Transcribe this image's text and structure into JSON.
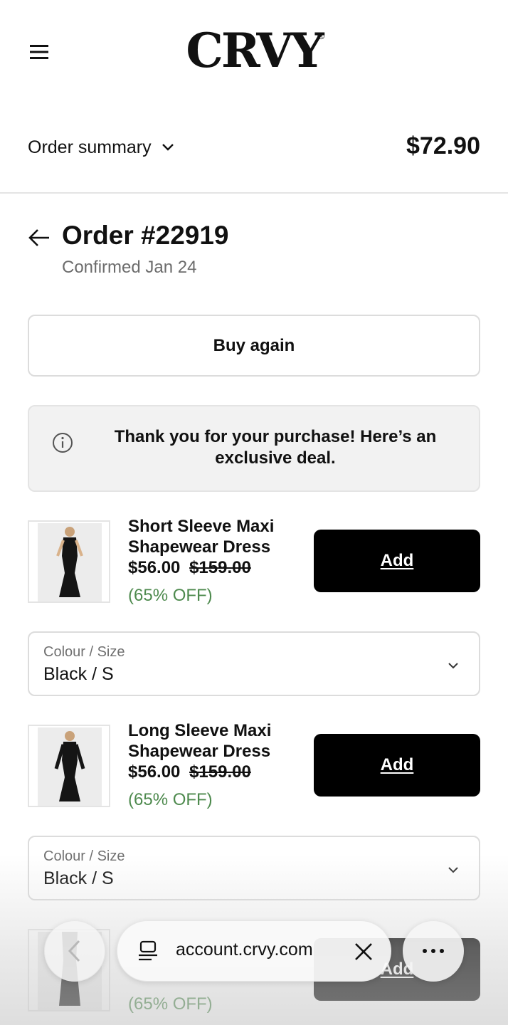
{
  "header": {
    "menu_icon": "hamburger-menu-icon",
    "brand": "CRVY",
    "brand_mark": "®"
  },
  "summary": {
    "label": "Order summary",
    "total": "$72.90"
  },
  "order": {
    "title": "Order #22919",
    "subtitle": "Confirmed Jan 24"
  },
  "actions": {
    "buy_again": "Buy again"
  },
  "notice": {
    "text": "Thank you for your purchase! Here’s an exclusive deal."
  },
  "products": [
    {
      "name": "Short Sleeve Maxi Shapewear Dress",
      "price": "$56.00",
      "compare_price": "$159.00",
      "discount": "(65% OFF)",
      "add_label": "Add",
      "option_label": "Colour / Size",
      "option_value": "Black / S"
    },
    {
      "name": "Long Sleeve Maxi Shapewear Dress",
      "price": "$56.00",
      "compare_price": "$159.00",
      "discount": "(65% OFF)",
      "add_label": "Add",
      "option_label": "Colour / Size",
      "option_value": "Black / S"
    },
    {
      "discount": "(65% OFF)",
      "add_label": "Add"
    }
  ],
  "browser": {
    "url": "account.crvy.com"
  },
  "colors": {
    "accent_green": "#4e8a4e",
    "button_black": "#000000"
  }
}
